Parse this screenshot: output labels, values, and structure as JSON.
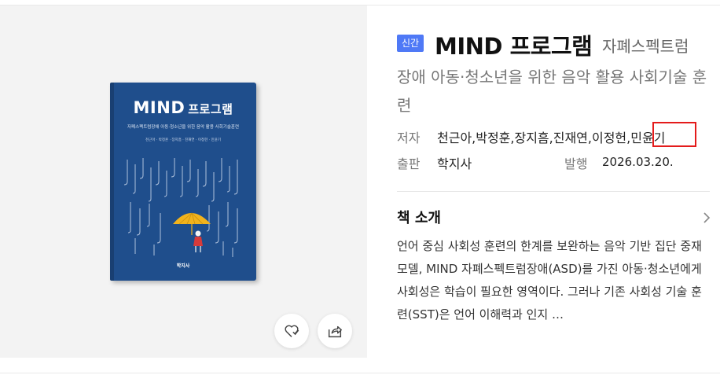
{
  "badge": "신간",
  "book": {
    "title": "MIND 프로그램",
    "title_suffix": "자폐스펙트럼",
    "subtitle": "장애 아동·청소년을 위한 음악 활용 사회기술 훈련",
    "cover": {
      "title_en": "MIND",
      "title_kr": "프로그램",
      "subtitle": "자폐스펙트럼장애 아동·청소년을 위한 음악 활용 사회기술훈련",
      "authors": "천근아 · 박정훈 · 장지흠 · 진재연 · 이정헌 · 민윤기",
      "publisher": "학지사"
    }
  },
  "meta": {
    "author_label": "저자",
    "authors": "천근아,박정훈,장지흠,진재연,이정헌,민윤기",
    "publisher_label": "출판",
    "publisher": "학지사",
    "date_label": "발행",
    "date": "2026.03.20."
  },
  "intro": {
    "title": "책 소개",
    "text": "언어 중심 사회성 훈련의 한계를 보완하는 음악 기반 집단 중재 모델, MIND 자폐스펙트럼장애(ASD)를 가진 아동·청소년에게 사회성은 학습이 필요한 영역이다. 그러나 기존 사회성 기술 훈련(SST)은 언어 이해력과 인지 …"
  },
  "icons": {
    "like": "heart-plus-icon",
    "share": "share-icon",
    "chevron": "chevron-right-icon"
  },
  "colors": {
    "badge": "#4f79f6",
    "highlight": "#e41b1b",
    "cover": "#1f4e8c"
  }
}
